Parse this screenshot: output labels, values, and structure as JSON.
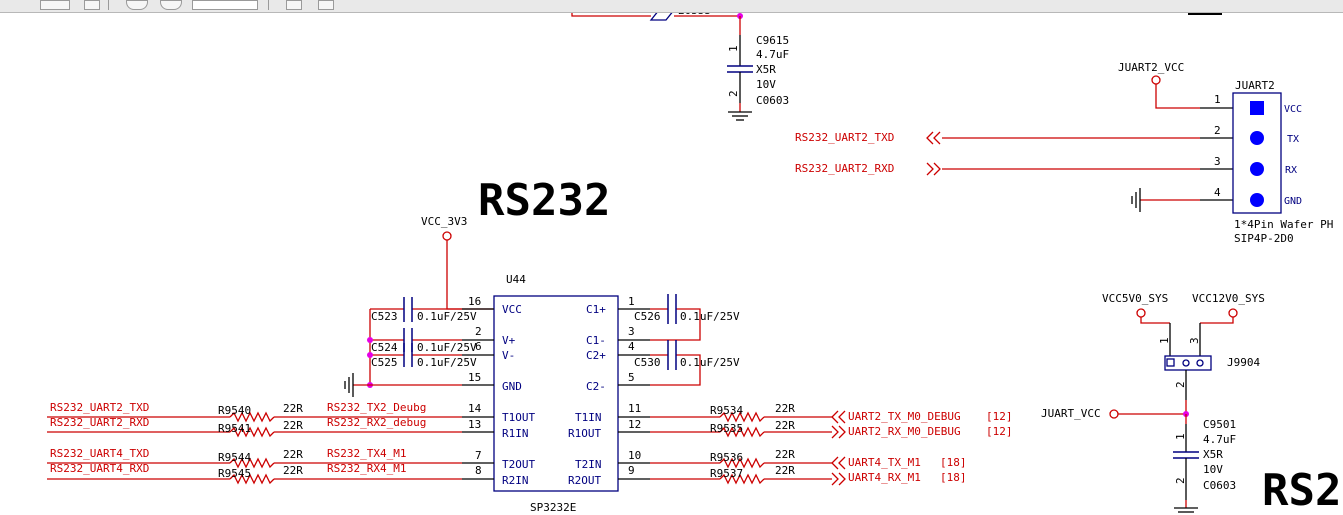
{
  "toolbar": {
    "zoom_value": ""
  },
  "sheet": {
    "title": "RS232",
    "title_partial": "RS2",
    "top_partial_label": "20555",
    "u44": {
      "ref": "U44",
      "part": "SP3232E",
      "pins": [
        {
          "num": "16",
          "name": "VCC"
        },
        {
          "num": "2",
          "name": "V+"
        },
        {
          "num": "6",
          "name": "V-"
        },
        {
          "num": "15",
          "name": "GND"
        },
        {
          "num": "14",
          "name": "T1OUT"
        },
        {
          "num": "13",
          "name": "R1IN"
        },
        {
          "num": "7",
          "name": "T2OUT"
        },
        {
          "num": "8",
          "name": "R2IN"
        },
        {
          "num": "1",
          "name": "C1+"
        },
        {
          "num": "3",
          "name": "C1-"
        },
        {
          "num": "4",
          "name": "C2+"
        },
        {
          "num": "5",
          "name": "C2-"
        },
        {
          "num": "11",
          "name": "T1IN"
        },
        {
          "num": "12",
          "name": "R1OUT"
        },
        {
          "num": "10",
          "name": "T2IN"
        },
        {
          "num": "9",
          "name": "R2OUT"
        }
      ]
    },
    "power": {
      "vcc_3v3": "VCC_3V3",
      "juart2_vcc": "JUART2_VCC",
      "vcc5v0_sys": "VCC5V0_SYS",
      "vcc12v0_sys": "VCC12V0_SYS",
      "juart_vcc": "JUART_VCC"
    },
    "caps": [
      {
        "ref": "C523",
        "value": "0.1uF/25V"
      },
      {
        "ref": "C524",
        "value": "0.1uF/25V"
      },
      {
        "ref": "C525",
        "value": "0.1uF/25V"
      },
      {
        "ref": "C526",
        "value": "0.1uF/25V"
      },
      {
        "ref": "C530",
        "value": "0.1uF/25V"
      }
    ],
    "c9615": {
      "ref": "C9615",
      "value": "4.7uF",
      "dielectric": "X5R",
      "voltage": "10V",
      "package": "C0603"
    },
    "c9501": {
      "ref": "C9501",
      "value": "4.7uF",
      "dielectric": "X5R",
      "voltage": "10V",
      "package": "C0603"
    },
    "resistors": [
      {
        "ref": "R9540",
        "value": "22R"
      },
      {
        "ref": "R9541",
        "value": "22R"
      },
      {
        "ref": "R9544",
        "value": "22R"
      },
      {
        "ref": "R9545",
        "value": "22R"
      },
      {
        "ref": "R9534",
        "value": "22R"
      },
      {
        "ref": "R9535",
        "value": "22R"
      },
      {
        "ref": "R9536",
        "value": "22R"
      },
      {
        "ref": "R9537",
        "value": "22R"
      }
    ],
    "nets_left": [
      "RS232_UART2_TXD",
      "RS232_UART2_RXD",
      "RS232_UART4_TXD",
      "RS232_UART4_RXD"
    ],
    "nets_mid": [
      "RS232_TX2_Deubg",
      "RS232_RX2_debug",
      "RS232_TX4_M1",
      "RS232_RX4_M1"
    ],
    "nets_right": [
      "UART2_TX_M0_DEBUG",
      "UART2_RX_M0_DEBUG",
      "UART4_TX_M1",
      "UART4_RX_M1"
    ],
    "refs_right": [
      "[12]",
      "[12]",
      "[18]",
      "[18]"
    ],
    "juart2": {
      "ref": "JUART2",
      "desc": "1*4Pin Wafer PH",
      "footprint": "SIP4P-2D0",
      "pins": [
        {
          "num": "1",
          "name": "VCC"
        },
        {
          "num": "2",
          "name": "TX"
        },
        {
          "num": "3",
          "name": "RX"
        },
        {
          "num": "4",
          "name": "GND"
        }
      ],
      "tx_net": "RS232_UART2_TXD",
      "rx_net": "RS232_UART2_RXD"
    },
    "j9904": {
      "ref": "J9904",
      "pins": [
        "1",
        "2",
        "3"
      ]
    },
    "cap_pins": [
      "1",
      "2"
    ]
  }
}
